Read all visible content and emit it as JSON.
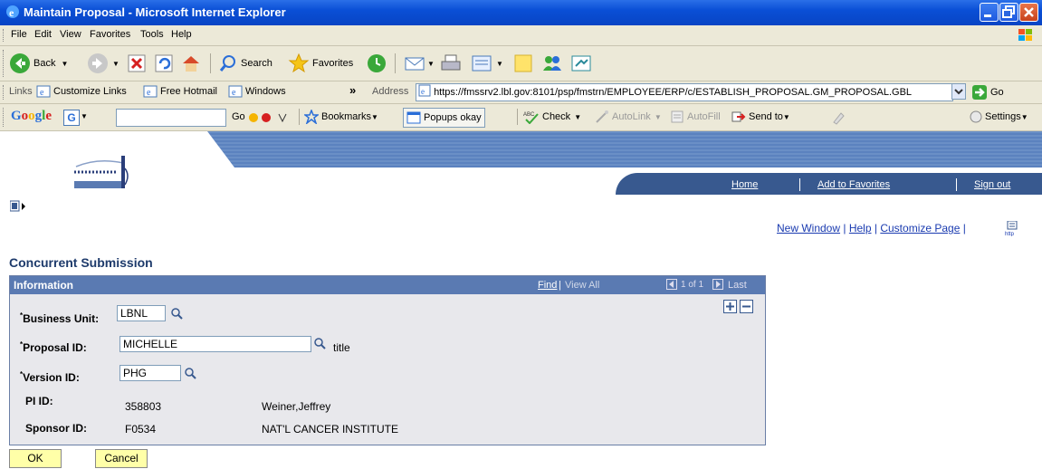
{
  "window": {
    "title": "Maintain Proposal - Microsoft Internet Explorer"
  },
  "menu": [
    "File",
    "Edit",
    "View",
    "Favorites",
    "Tools",
    "Help"
  ],
  "toolbar": {
    "back": "Back",
    "search": "Search",
    "favorites": "Favorites"
  },
  "links_bar": {
    "links_label": "Links",
    "items": [
      "Customize Links",
      "Free Hotmail",
      "Windows"
    ],
    "chevron": "»",
    "address_label": "Address",
    "address_url": "https://fmssrv2.lbl.gov:8101/psp/fmstrn/EMPLOYEE/ERP/c/ESTABLISH_PROPOSAL.GM_PROPOSAL.GBL",
    "go_label": "Go"
  },
  "google_bar": {
    "go": "Go",
    "bookmarks": "Bookmarks",
    "popups": "Popups okay",
    "check": "Check",
    "autolink": "AutoLink",
    "autofill": "AutoFill",
    "sendto": "Send to",
    "settings": "Settings"
  },
  "ps_nav": {
    "home": "Home",
    "add_favorites": "Add to Favorites",
    "sign_out": "Sign out"
  },
  "page_links": {
    "new_window": "New Window",
    "help": "Help",
    "customize": "Customize Page"
  },
  "page": {
    "title": "Concurrent Submission"
  },
  "info_box": {
    "title": "Information",
    "find": "Find",
    "view_all": "View All",
    "paging": "1 of 1",
    "last": "Last"
  },
  "form": {
    "business_unit_label": "Business Unit:",
    "business_unit": "LBNL",
    "proposal_id_label": "Proposal ID:",
    "proposal_id": "MICHELLE",
    "proposal_desc": "title",
    "version_id_label": "Version ID:",
    "version_id": "PHG",
    "pi_id_label": "PI ID:",
    "pi_id": "358803",
    "pi_name": "Weiner,Jeffrey",
    "sponsor_id_label": "Sponsor ID:",
    "sponsor_id": "F0534",
    "sponsor_name": "NAT'L CANCER INSTITUTE"
  },
  "buttons": {
    "ok": "OK",
    "cancel": "Cancel"
  },
  "colors": {
    "title_bar": "#0a4fd6",
    "ps_header": "#5a7ab2",
    "nav_band": "#38598f",
    "button_bg": "#ffffa8"
  }
}
